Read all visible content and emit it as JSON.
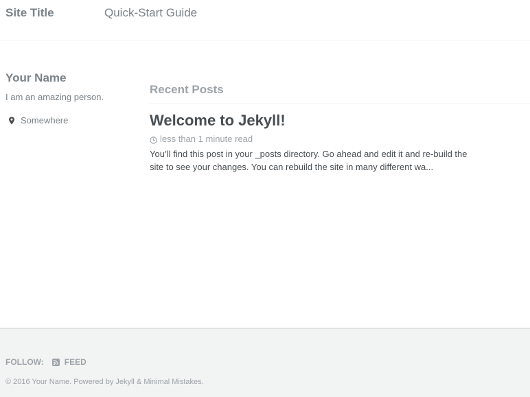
{
  "header": {
    "site_title": "Site Title",
    "nav_items": [
      "Quick-Start Guide"
    ]
  },
  "sidebar": {
    "author_name": "Your Name",
    "author_bio": "I am an amazing person.",
    "location": "Somewhere",
    "location_icon": "map-marker-icon"
  },
  "main": {
    "section_title": "Recent Posts",
    "posts": [
      {
        "title": "Welcome to Jekyll!",
        "read_time": "less than 1 minute read",
        "excerpt": "You’ll find this post in your _posts directory. Go ahead and edit it and re-build the site to see your changes. You can rebuild the site in many different wa..."
      }
    ]
  },
  "footer": {
    "follow_label": "FOLLOW:",
    "feed_label": "FEED",
    "feed_icon": "rss-icon",
    "copyright": "© 2016 Your Name. Powered by Jekyll & Minimal Mistakes."
  }
}
